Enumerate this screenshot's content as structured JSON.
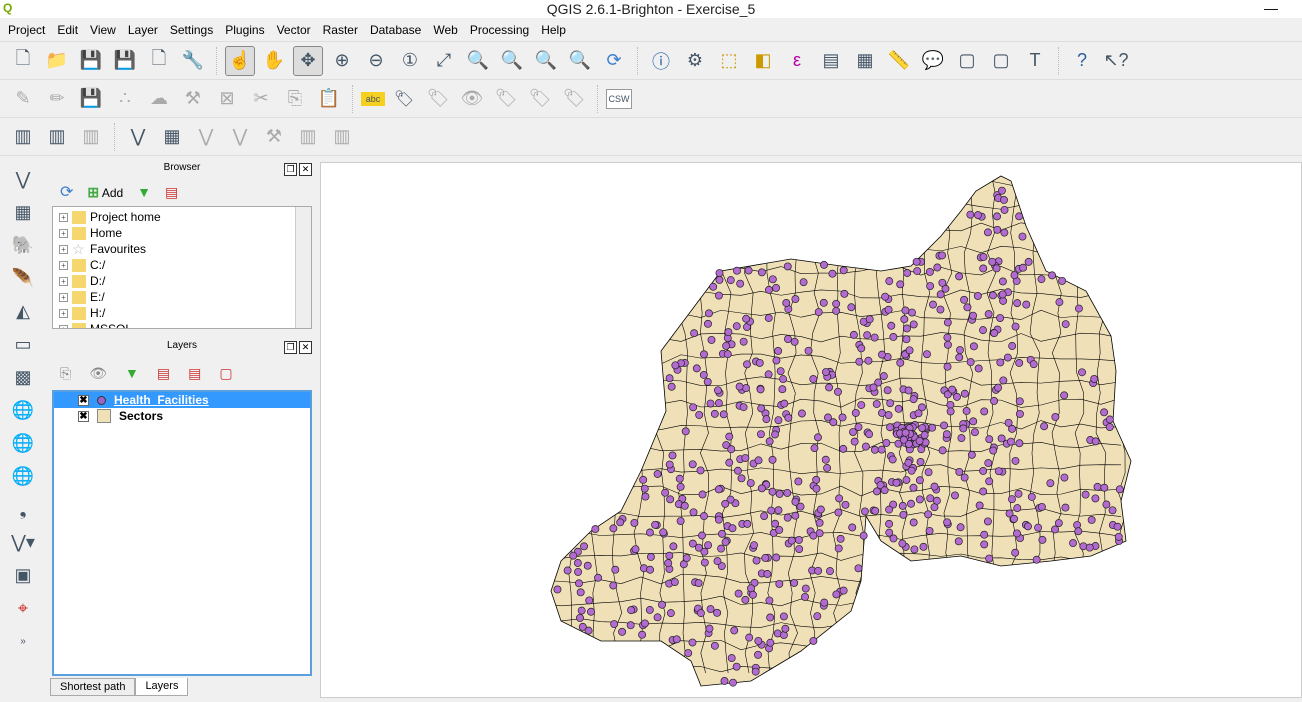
{
  "window": {
    "title": "QGIS 2.6.1-Brighton - Exercise_5",
    "minimize": "—"
  },
  "menu": [
    "Project",
    "Edit",
    "View",
    "Layer",
    "Settings",
    "Plugins",
    "Vector",
    "Raster",
    "Database",
    "Web",
    "Processing",
    "Help"
  ],
  "browser": {
    "title": "Browser",
    "add_label": "Add",
    "items": [
      "Project home",
      "Home",
      "Favourites",
      "C:/",
      "D:/",
      "E:/",
      "H:/",
      "MSSQL"
    ]
  },
  "layers": {
    "title": "Layers",
    "items": [
      {
        "name": "Health_Facilities",
        "checked": true,
        "selected": true,
        "symbol": "circle",
        "color": "#9966cc"
      },
      {
        "name": "Sectors",
        "checked": true,
        "selected": false,
        "symbol": "polygon",
        "color": "#f0e0b8"
      }
    ]
  },
  "tabs": [
    {
      "label": "Shortest path",
      "active": false
    },
    {
      "label": "Layers",
      "active": true
    }
  ],
  "colors": {
    "polygon_fill": "#f0e0b8",
    "point_fill": "#b36bd1",
    "selection": "#3399ff"
  },
  "toolbar_labels": {
    "csw": "CSW",
    "abc": "abc"
  }
}
